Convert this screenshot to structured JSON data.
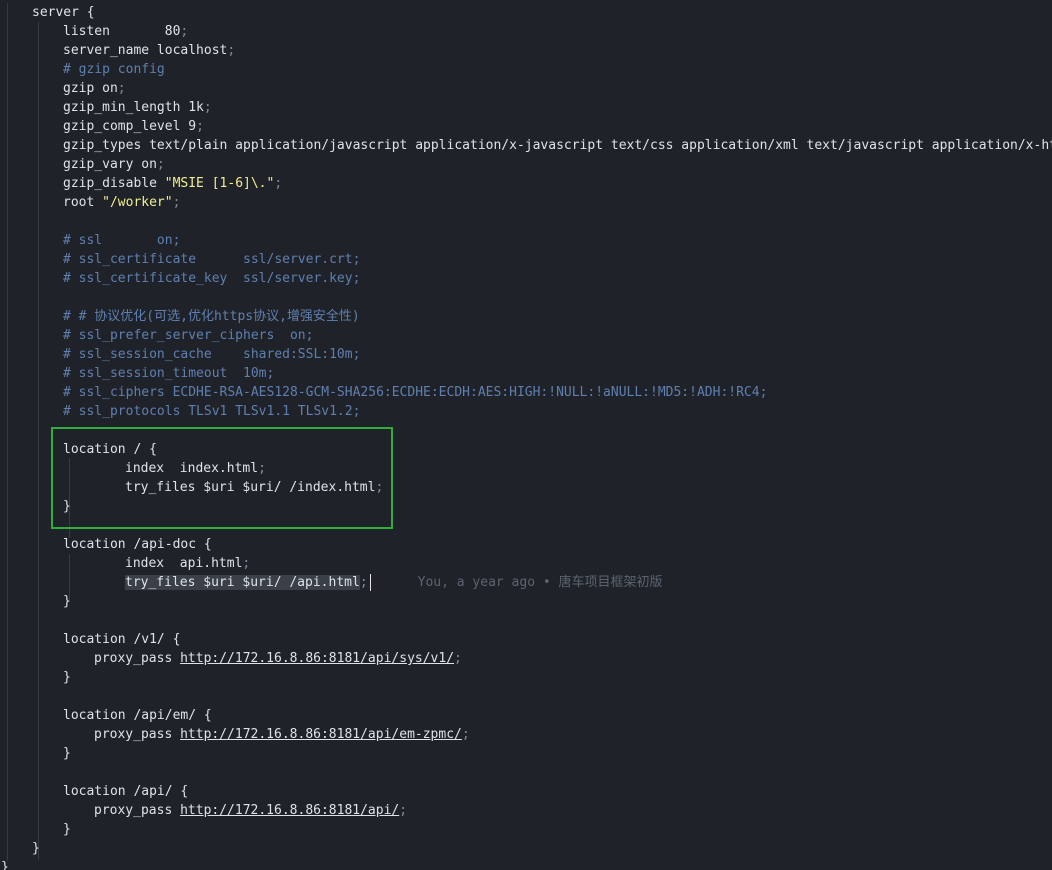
{
  "colors": {
    "background": "#1f2329",
    "text": "#dde3ea",
    "comment": "#5f7fb0",
    "punct": "#7f8b99",
    "string": "#f3ee8e",
    "selection": "#3b4048",
    "highlight_box": "#2fae3a",
    "blame": "#5c6370"
  },
  "lines": [
    {
      "indent": 1,
      "tokens": [
        {
          "t": "server {",
          "c": "text"
        }
      ]
    },
    {
      "indent": 2,
      "tokens": [
        {
          "t": "listen       80",
          "c": "text"
        },
        {
          "t": ";",
          "c": "punct"
        }
      ]
    },
    {
      "indent": 2,
      "tokens": [
        {
          "t": "server_name localhost",
          "c": "text"
        },
        {
          "t": ";",
          "c": "punct"
        }
      ]
    },
    {
      "indent": 2,
      "tokens": [
        {
          "t": "# gzip config",
          "c": "comment"
        }
      ]
    },
    {
      "indent": 2,
      "tokens": [
        {
          "t": "gzip on",
          "c": "text"
        },
        {
          "t": ";",
          "c": "punct"
        }
      ]
    },
    {
      "indent": 2,
      "tokens": [
        {
          "t": "gzip_min_length 1k",
          "c": "text"
        },
        {
          "t": ";",
          "c": "punct"
        }
      ]
    },
    {
      "indent": 2,
      "tokens": [
        {
          "t": "gzip_comp_level 9",
          "c": "text"
        },
        {
          "t": ";",
          "c": "punct"
        }
      ]
    },
    {
      "indent": 2,
      "tokens": [
        {
          "t": "gzip_types text/plain application/javascript application/x-javascript text/css application/xml text/javascript application/x-http",
          "c": "text"
        }
      ]
    },
    {
      "indent": 2,
      "tokens": [
        {
          "t": "gzip_vary on",
          "c": "text"
        },
        {
          "t": ";",
          "c": "punct"
        }
      ]
    },
    {
      "indent": 2,
      "tokens": [
        {
          "t": "gzip_disable ",
          "c": "text"
        },
        {
          "t": "\"MSIE [1-6]\\.\"",
          "c": "string"
        },
        {
          "t": ";",
          "c": "punct"
        }
      ]
    },
    {
      "indent": 2,
      "tokens": [
        {
          "t": "root ",
          "c": "text"
        },
        {
          "t": "\"/worker\"",
          "c": "string"
        },
        {
          "t": ";",
          "c": "punct"
        }
      ]
    },
    {
      "indent": 0,
      "tokens": []
    },
    {
      "indent": 2,
      "tokens": [
        {
          "t": "# ssl       on;",
          "c": "comment"
        }
      ]
    },
    {
      "indent": 2,
      "tokens": [
        {
          "t": "# ssl_certificate      ssl/server.crt;",
          "c": "comment"
        }
      ]
    },
    {
      "indent": 2,
      "tokens": [
        {
          "t": "# ssl_certificate_key  ssl/server.key;",
          "c": "comment"
        }
      ]
    },
    {
      "indent": 0,
      "tokens": []
    },
    {
      "indent": 2,
      "tokens": [
        {
          "t": "# # 协议优化(可选,优化https协议,增强安全性)",
          "c": "comment"
        }
      ]
    },
    {
      "indent": 2,
      "tokens": [
        {
          "t": "# ssl_prefer_server_ciphers  on;",
          "c": "comment"
        }
      ]
    },
    {
      "indent": 2,
      "tokens": [
        {
          "t": "# ssl_session_cache    shared:SSL:10m;",
          "c": "comment"
        }
      ]
    },
    {
      "indent": 2,
      "tokens": [
        {
          "t": "# ssl_session_timeout  10m;",
          "c": "comment"
        }
      ]
    },
    {
      "indent": 2,
      "tokens": [
        {
          "t": "# ssl_ciphers ECDHE-RSA-AES128-GCM-SHA256:ECDHE:ECDH:AES:HIGH:!NULL:!aNULL:!MD5:!ADH:!RC4;",
          "c": "comment"
        }
      ]
    },
    {
      "indent": 2,
      "tokens": [
        {
          "t": "# ssl_protocols TLSv1 TLSv1.1 TLSv1.2;",
          "c": "comment"
        }
      ]
    },
    {
      "indent": 0,
      "tokens": []
    },
    {
      "indent": 2,
      "tokens": [
        {
          "t": "location / {",
          "c": "text"
        }
      ]
    },
    {
      "indent": 4,
      "tokens": [
        {
          "t": "index  index.html",
          "c": "text"
        },
        {
          "t": ";",
          "c": "punct"
        }
      ]
    },
    {
      "indent": 4,
      "tokens": [
        {
          "t": "try_files $uri $uri/ /index.html",
          "c": "text"
        },
        {
          "t": ";",
          "c": "punct"
        }
      ]
    },
    {
      "indent": 2,
      "tokens": [
        {
          "t": "}",
          "c": "text"
        }
      ]
    },
    {
      "indent": 0,
      "tokens": []
    },
    {
      "indent": 2,
      "tokens": [
        {
          "t": "location /api-doc {",
          "c": "text"
        }
      ]
    },
    {
      "indent": 4,
      "tokens": [
        {
          "t": "index  api.html",
          "c": "text"
        },
        {
          "t": ";",
          "c": "punct"
        }
      ]
    },
    {
      "indent": 4,
      "tokens": [
        {
          "t": "try_files $uri $uri/ /api.html",
          "c": "selected"
        },
        {
          "t": ";",
          "c": "punct"
        }
      ],
      "cursor": true,
      "blame": "You, a year ago • 唐车项目框架初版"
    },
    {
      "indent": 2,
      "tokens": [
        {
          "t": "}",
          "c": "text"
        }
      ]
    },
    {
      "indent": 0,
      "tokens": []
    },
    {
      "indent": 2,
      "tokens": [
        {
          "t": "location /v1/ {",
          "c": "text"
        }
      ]
    },
    {
      "indent": 3,
      "tokens": [
        {
          "t": "proxy_pass ",
          "c": "text"
        },
        {
          "t": "http://172.16.8.86:8181/api/sys/v1/",
          "c": "link"
        },
        {
          "t": ";",
          "c": "punct"
        }
      ]
    },
    {
      "indent": 2,
      "tokens": [
        {
          "t": "}",
          "c": "text"
        }
      ]
    },
    {
      "indent": 0,
      "tokens": []
    },
    {
      "indent": 2,
      "tokens": [
        {
          "t": "location /api/em/ {",
          "c": "text"
        }
      ]
    },
    {
      "indent": 3,
      "tokens": [
        {
          "t": "proxy_pass ",
          "c": "text"
        },
        {
          "t": "http://172.16.8.86:8181/api/em-zpmc/",
          "c": "link"
        },
        {
          "t": ";",
          "c": "punct"
        }
      ]
    },
    {
      "indent": 2,
      "tokens": [
        {
          "t": "}",
          "c": "text"
        }
      ]
    },
    {
      "indent": 0,
      "tokens": []
    },
    {
      "indent": 2,
      "tokens": [
        {
          "t": "location /api/ {",
          "c": "text"
        }
      ]
    },
    {
      "indent": 3,
      "tokens": [
        {
          "t": "proxy_pass ",
          "c": "text"
        },
        {
          "t": "http://172.16.8.86:8181/api/",
          "c": "link"
        },
        {
          "t": ";",
          "c": "punct"
        }
      ]
    },
    {
      "indent": 2,
      "tokens": [
        {
          "t": "}",
          "c": "text"
        }
      ]
    },
    {
      "indent": 1,
      "tokens": [
        {
          "t": "}",
          "c": "text"
        }
      ]
    },
    {
      "indent": 0,
      "tokens": [
        {
          "t": "}",
          "c": "text"
        }
      ]
    }
  ]
}
